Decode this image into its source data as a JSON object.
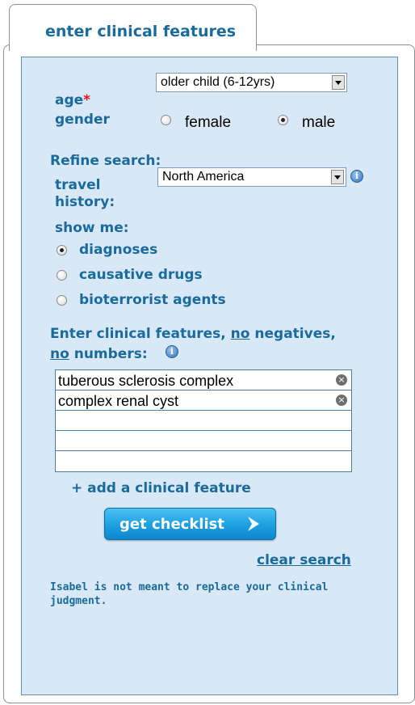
{
  "tab": {
    "label": "enter clinical features"
  },
  "age": {
    "label": "age",
    "required_mark": "*",
    "selected": "older child (6-12yrs)"
  },
  "gender": {
    "label": "gender",
    "options": [
      {
        "label": "female",
        "selected": false
      },
      {
        "label": "male",
        "selected": true
      }
    ]
  },
  "refine": {
    "heading": "Refine search:",
    "travel_label_1": "travel",
    "travel_label_2": "history:",
    "travel_selected": "North America",
    "show_me_label": "show me:",
    "show_options": [
      {
        "label": "diagnoses",
        "selected": true
      },
      {
        "label": "causative drugs",
        "selected": false
      },
      {
        "label": "bioterrorist agents",
        "selected": false
      }
    ]
  },
  "features": {
    "instr_part1": "Enter clinical features, ",
    "instr_no1": "no",
    "instr_part2": " negatives,",
    "instr_no2": "no",
    "instr_part3": " numbers:",
    "items": [
      "tuberous sclerosis complex",
      "complex renal cyst",
      "",
      "",
      ""
    ],
    "remove_glyph": "×",
    "add_label": "+ add a clinical feature"
  },
  "actions": {
    "get_checklist": "get checklist",
    "clear_search": "clear search"
  },
  "disclaimer": "Isabel is not meant to replace your clinical judgment.",
  "colors": {
    "accent": "#1a6b9c",
    "panel": "#d8e8f6",
    "required": "#e8141a",
    "button": "#1ea2e2"
  },
  "icons": {
    "info": "info-icon",
    "remove": "remove-icon",
    "arrow": "arrow-right-icon",
    "dropdown": "dropdown-arrow-icon"
  }
}
